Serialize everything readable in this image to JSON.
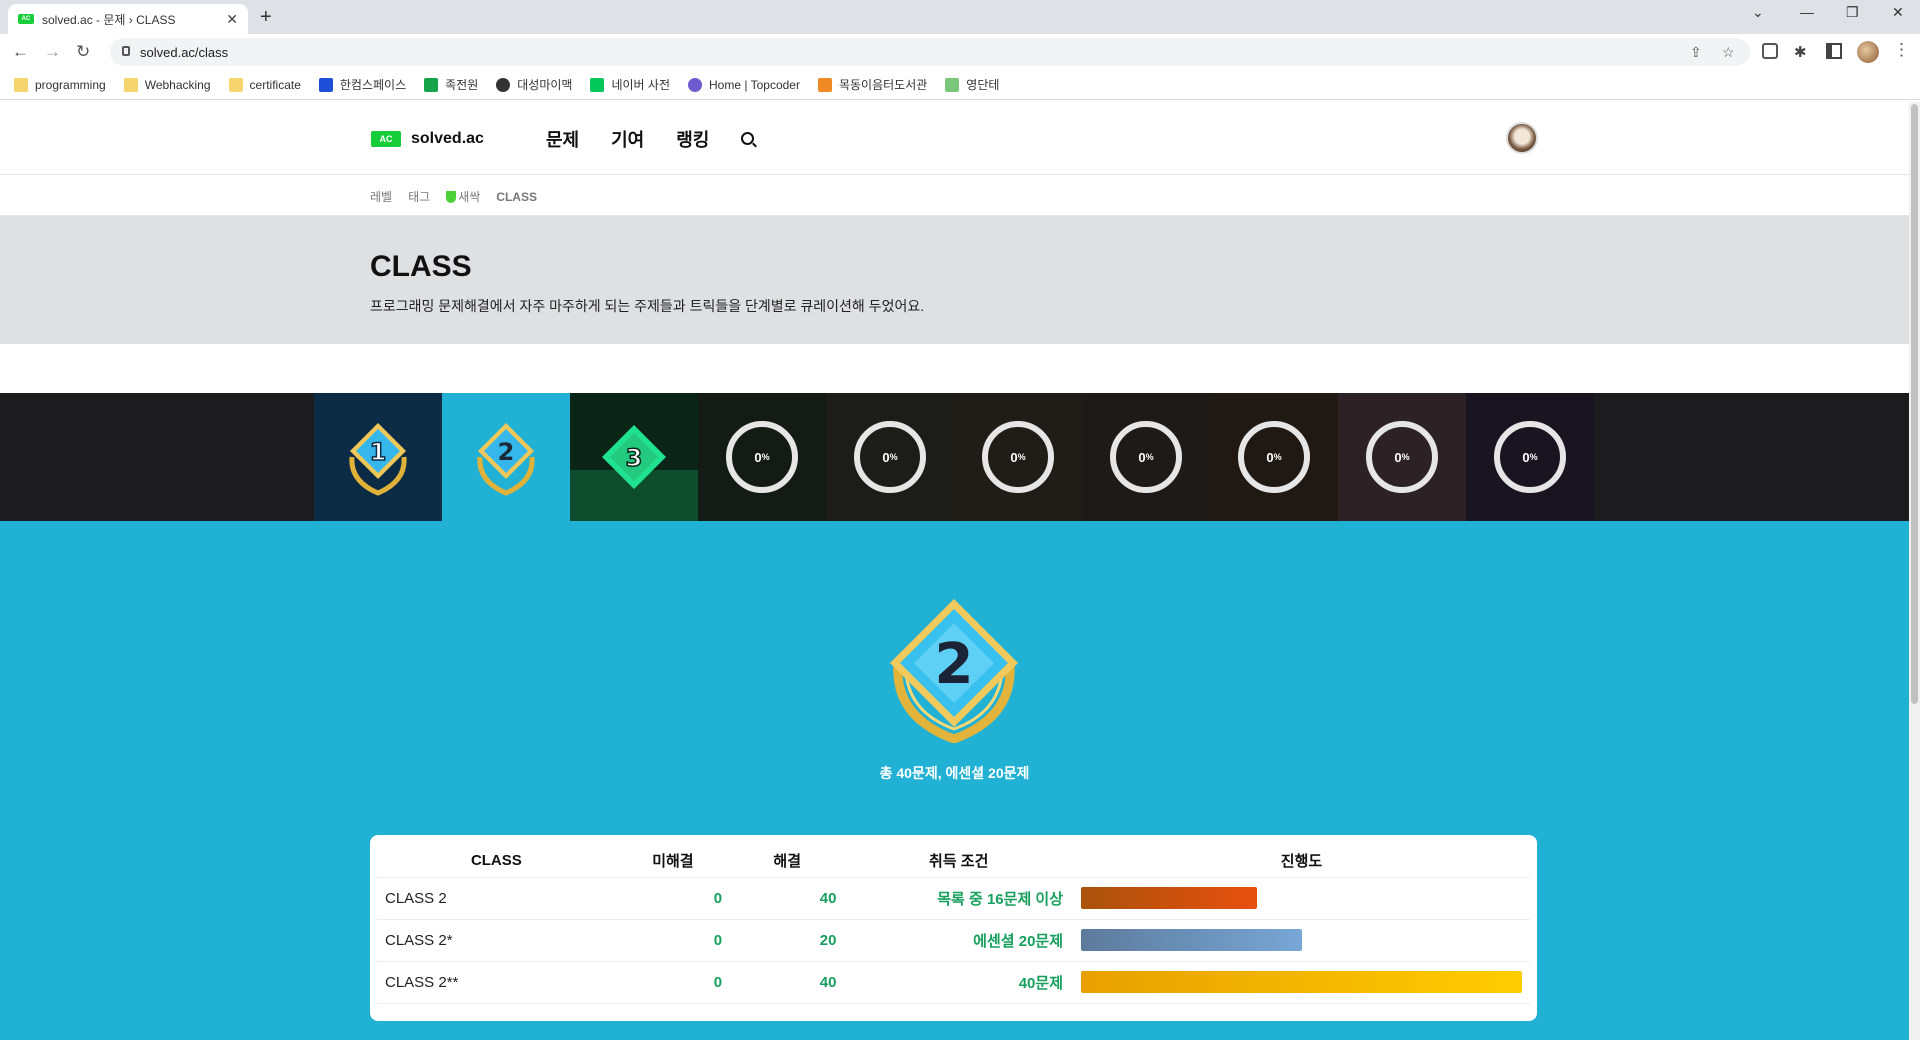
{
  "browser": {
    "tab_title": "solved.ac - 문제 › CLASS",
    "favicon_text": "AC",
    "url": "solved.ac/class",
    "bookmarks": [
      {
        "label": "programming",
        "icon": "folder-icon"
      },
      {
        "label": "Webhacking",
        "icon": "folder-icon"
      },
      {
        "label": "certificate",
        "icon": "folder-icon"
      },
      {
        "label": "한컴스페이스",
        "icon": "d-icon"
      },
      {
        "label": "족전원",
        "icon": "green-square-icon"
      },
      {
        "label": "대성마이맥",
        "icon": "globe-icon"
      },
      {
        "label": "네이버 사전",
        "icon": "naver-icon"
      },
      {
        "label": "Home | Topcoder",
        "icon": "topcoder-icon"
      },
      {
        "label": "목동이음터도서관",
        "icon": "library-icon"
      },
      {
        "label": "영단테",
        "icon": "book-icon"
      }
    ]
  },
  "site": {
    "logo_badge": "AC",
    "logo_text": "solved.ac",
    "nav": [
      "문제",
      "기여",
      "랭킹"
    ],
    "subnav": [
      "레벨",
      "태그",
      "새싹",
      "CLASS"
    ]
  },
  "hero": {
    "title": "CLASS",
    "description": "프로그래밍 문제해결에서 자주 마주하게 되는 주제들과 트릭들을 단계별로 큐레이션해 두었어요."
  },
  "class_strip": {
    "badges": [
      {
        "label": "1",
        "type": "badge"
      },
      {
        "label": "2",
        "type": "badge"
      },
      {
        "label": "3",
        "type": "badge"
      },
      {
        "label": "0",
        "type": "progress",
        "unit": "%"
      },
      {
        "label": "0",
        "type": "progress",
        "unit": "%"
      },
      {
        "label": "0",
        "type": "progress",
        "unit": "%"
      },
      {
        "label": "0",
        "type": "progress",
        "unit": "%"
      },
      {
        "label": "0",
        "type": "progress",
        "unit": "%"
      },
      {
        "label": "0",
        "type": "progress",
        "unit": "%"
      },
      {
        "label": "0",
        "type": "progress",
        "unit": "%"
      }
    ],
    "colors": [
      "#0c2b44",
      "#20b1d4",
      "#0a2418",
      "#141a14",
      "#1c1c18",
      "#201c18",
      "#1e1a18",
      "#201812",
      "#2c2226",
      "#1a1420"
    ]
  },
  "detail": {
    "big_badge_label": "2",
    "summary_parts": [
      "총 ",
      "40",
      "문제, 에센셜 ",
      "20",
      "문제"
    ],
    "table": {
      "headers": [
        "CLASS",
        "미해결",
        "해결",
        "취득 조건",
        "진행도"
      ],
      "rows": [
        {
          "name": "CLASS 2",
          "unsolved": "0",
          "solved": "40",
          "condition": "목록 중 16문제 이상",
          "progress": 0.4,
          "color_from": "#a9520c",
          "color_to": "#e8500e"
        },
        {
          "name": "CLASS 2*",
          "unsolved": "0",
          "solved": "20",
          "condition": "에센셜 20문제",
          "progress": 0.5,
          "color_from": "#5d7b9b",
          "color_to": "#78a6d6"
        },
        {
          "name": "CLASS 2**",
          "unsolved": "0",
          "solved": "40",
          "condition": "40문제",
          "progress": 1.0,
          "color_from": "#e8a000",
          "color_to": "#ffcc00"
        }
      ]
    }
  }
}
